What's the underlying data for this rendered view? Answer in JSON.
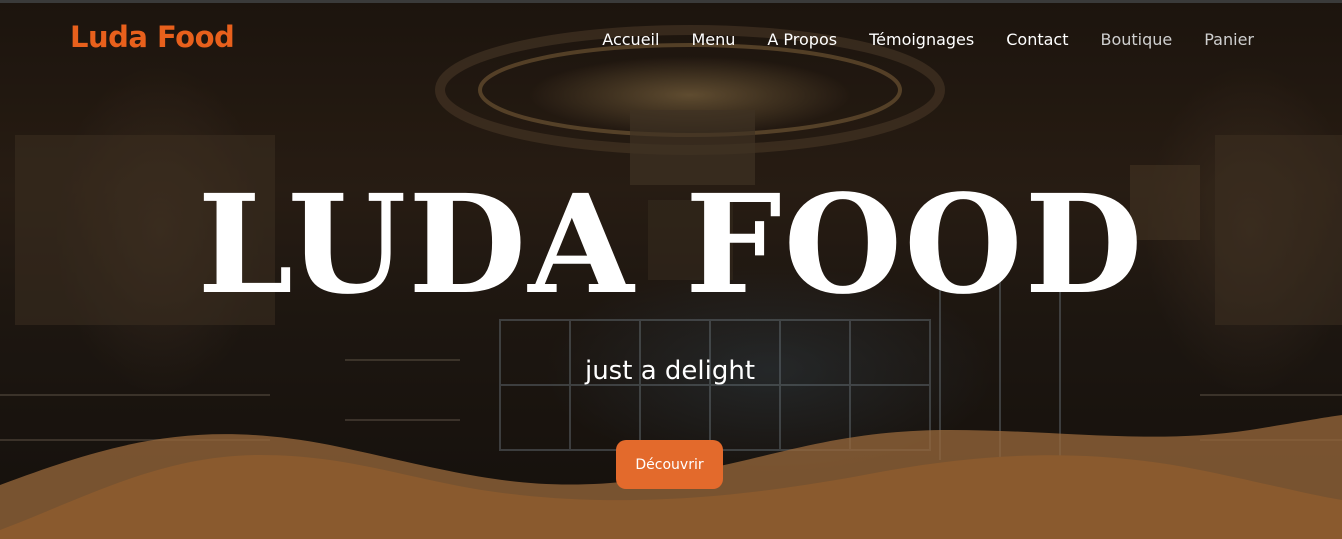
{
  "brand": {
    "name": "Luda Food",
    "color": "#e8601c"
  },
  "nav": {
    "items": [
      {
        "label": "Accueil",
        "style": "active"
      },
      {
        "label": "Menu",
        "style": "active"
      },
      {
        "label": "A Propos",
        "style": "active"
      },
      {
        "label": "Témoignages",
        "style": "active"
      },
      {
        "label": "Contact",
        "style": "active"
      },
      {
        "label": "Boutique",
        "style": "muted"
      },
      {
        "label": "Panier",
        "style": "muted"
      }
    ]
  },
  "hero": {
    "title": "LUDA FOOD",
    "tagline": "just a delight",
    "cta_label": "Découvrir",
    "cta_color": "#e36a2c",
    "wave_color": "#8a5a2e"
  }
}
